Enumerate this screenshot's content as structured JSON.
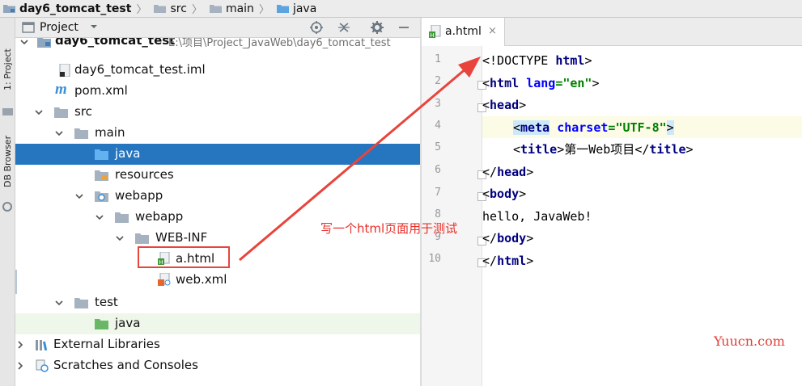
{
  "breadcrumb": [
    {
      "label": "day6_tomcat_test",
      "icon": "module-folder-icon",
      "bold": true
    },
    {
      "label": "src",
      "icon": "folder-icon"
    },
    {
      "label": "main",
      "icon": "folder-icon"
    },
    {
      "label": "java",
      "icon": "source-folder-icon"
    }
  ],
  "tool_strip": {
    "project_tab": "1: Project",
    "db_tab": "DB Browser"
  },
  "project_panel": {
    "title": "Project",
    "tree": [
      {
        "label": "day6_tomcat_test",
        "path": "E:\\项目\\Project_JavaWeb\\day6_tomcat_test",
        "icon": "module-folder-icon",
        "arrow": "down",
        "bold": true
      },
      {
        "label": "day6_tomcat_test.iml",
        "icon": "iml-file-icon"
      },
      {
        "label": "pom.xml",
        "icon": "maven-icon"
      },
      {
        "label": "src",
        "icon": "folder-icon",
        "arrow": "down"
      },
      {
        "label": "main",
        "icon": "folder-icon",
        "arrow": "down"
      },
      {
        "label": "java",
        "icon": "source-folder-icon",
        "selected": true
      },
      {
        "label": "resources",
        "icon": "resources-folder-icon"
      },
      {
        "label": "webapp",
        "icon": "web-folder-icon",
        "arrow": "down"
      },
      {
        "label": "webapp",
        "icon": "folder-icon",
        "arrow": "down"
      },
      {
        "label": "WEB-INF",
        "icon": "folder-icon",
        "arrow": "down"
      },
      {
        "label": "a.html",
        "icon": "html-file-icon"
      },
      {
        "label": "web.xml",
        "icon": "xml-file-icon"
      },
      {
        "label": "test",
        "icon": "folder-icon",
        "arrow": "down"
      },
      {
        "label": "java",
        "icon": "test-folder-icon",
        "green": true
      },
      {
        "label": "External Libraries",
        "icon": "libraries-icon",
        "arrow": "right"
      },
      {
        "label": "Scratches and Consoles",
        "icon": "scratches-icon",
        "arrow": "right"
      }
    ]
  },
  "editor": {
    "tab": {
      "label": "a.html",
      "close": "×"
    },
    "line_numbers": [
      "1",
      "2",
      "3",
      "4",
      "5",
      "6",
      "7",
      "8",
      "9",
      "10"
    ],
    "lines": {
      "l1": {
        "open": "<!DOCTYPE ",
        "tag": "html",
        "close": ">"
      },
      "l2": {
        "open": "<",
        "tag": "html",
        "sp": " ",
        "attr": "lang",
        "eq": "=",
        "val": "\"en\"",
        "close": ">"
      },
      "l3": {
        "open": "<",
        "tag": "head",
        "close": ">"
      },
      "l4": {
        "open": "<",
        "tag": "meta",
        "sp": " ",
        "attr": "charset",
        "eq": "=",
        "val": "\"UTF-8\"",
        "close": ">"
      },
      "l5": {
        "open": "<",
        "tag": "title",
        "close": ">",
        "text": "第一Web项目",
        "endopen": "</",
        "endtag": "title",
        "endclose": ">"
      },
      "l6": {
        "open": "</",
        "tag": "head",
        "close": ">"
      },
      "l7": {
        "open": "<",
        "tag": "body",
        "close": ">"
      },
      "l8": {
        "text": "hello, JavaWeb!"
      },
      "l9": {
        "open": "</",
        "tag": "body",
        "close": ">"
      },
      "l10": {
        "open": "</",
        "tag": "html",
        "close": ">"
      }
    }
  },
  "annotation": {
    "text": "写一个html页面用于测试",
    "color": "#e8302a"
  },
  "watermark": "Yuucn.com",
  "colors": {
    "selection": "#2675bf",
    "tag": "#000080",
    "attr": "#0000ff",
    "string": "#008000",
    "annotation": "#e8443b"
  }
}
